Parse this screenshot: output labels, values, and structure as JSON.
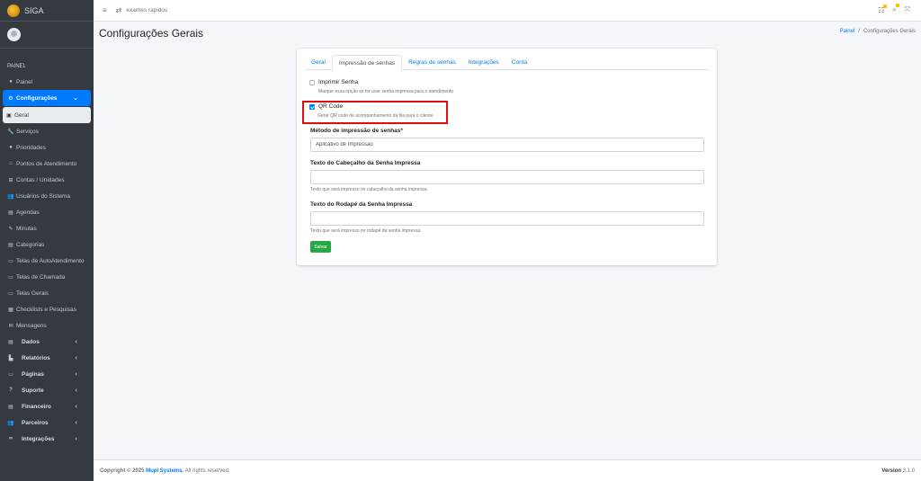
{
  "brand": {
    "name": "SIGA"
  },
  "sidebar": {
    "header": "PAINEL",
    "items": [
      {
        "icon": "●",
        "label": "Painel"
      },
      {
        "icon": "⚙",
        "label": "Configurações",
        "chevron": "⌄"
      },
      {
        "icon": "▣",
        "label": "Geral"
      },
      {
        "icon": "🔧",
        "label": "Serviços"
      },
      {
        "icon": "●",
        "label": "Prioridades"
      },
      {
        "icon": "⌂",
        "label": "Pontos de Atendimento"
      },
      {
        "icon": "⊞",
        "label": "Contas / Unidades"
      },
      {
        "icon": "👥",
        "label": "Usuários do Sistema"
      },
      {
        "icon": "▤",
        "label": "Agendas"
      },
      {
        "icon": "✎",
        "label": "Minutas"
      },
      {
        "icon": "▤",
        "label": "Categorias"
      },
      {
        "icon": "▭",
        "label": "Telas de AutoAtendimento"
      },
      {
        "icon": "▭",
        "label": "Telas de Chamada"
      },
      {
        "icon": "▭",
        "label": "Telas Gerais"
      },
      {
        "icon": "▦",
        "label": "Checklists e Pesquisas"
      },
      {
        "icon": "✉",
        "label": "Mensagens"
      }
    ],
    "groups": [
      {
        "icon": "▤",
        "label": "Dados",
        "chevron": "‹"
      },
      {
        "icon": "▙",
        "label": "Relatórios",
        "chevron": "‹"
      },
      {
        "icon": "▭",
        "label": "Páginas",
        "chevron": "‹"
      },
      {
        "icon": "?",
        "label": "Suporte",
        "chevron": "‹"
      },
      {
        "icon": "▤",
        "label": "Financeiro",
        "chevron": "‹"
      },
      {
        "icon": "👥",
        "label": "Parceiros",
        "chevron": "‹"
      },
      {
        "icon": "∞",
        "label": "Integrações",
        "chevron": "‹"
      }
    ]
  },
  "topbar": {
    "menu_icon": "≡",
    "swap_icon": "⇄",
    "link": "exames rapidos",
    "icons": [
      "☷",
      "⌕",
      "⤧"
    ]
  },
  "header": {
    "title": "Configurações Gerais",
    "breadcrumb": {
      "home": "Painel",
      "sep": "/",
      "current": "Configurações Gerais"
    }
  },
  "tabs": [
    "Geral",
    "Impressão de senhas",
    "Regras de senhas",
    "Integrações",
    "Conta"
  ],
  "form": {
    "print_ticket": {
      "label": "Imprimir Senha",
      "help": "Marque essa opção se for usar senha impressa para o atendimento",
      "checked": false
    },
    "qr_code": {
      "label": "QR Code",
      "help": "Gerar QR code de acompanhamento da fila para o cliente",
      "checked": true
    },
    "print_method": {
      "label": "Método de impressão de senhas*",
      "value": "Aplicativo de Impressão"
    },
    "header_text": {
      "label": "Texto do Cabeçalho da Senha Impressa",
      "value": "",
      "help": "Texto que será impresso no cabeçalho da senha impressa."
    },
    "footer_text": {
      "label": "Texto do Rodapé da Senha Impressa",
      "value": "",
      "help": "Texto que será impresso no rodapé da senha impressa."
    },
    "save_label": "Salvar"
  },
  "footer": {
    "copyright_prefix": "Copyright © 2025",
    "company": "Mupi Systems.",
    "rights": "All rights reserved.",
    "version_label": "Version",
    "version": "3.1.0"
  },
  "colors": {
    "primary": "#007bff",
    "success": "#28a745",
    "sidebar": "#343a40",
    "highlight": "#e10b0b"
  }
}
